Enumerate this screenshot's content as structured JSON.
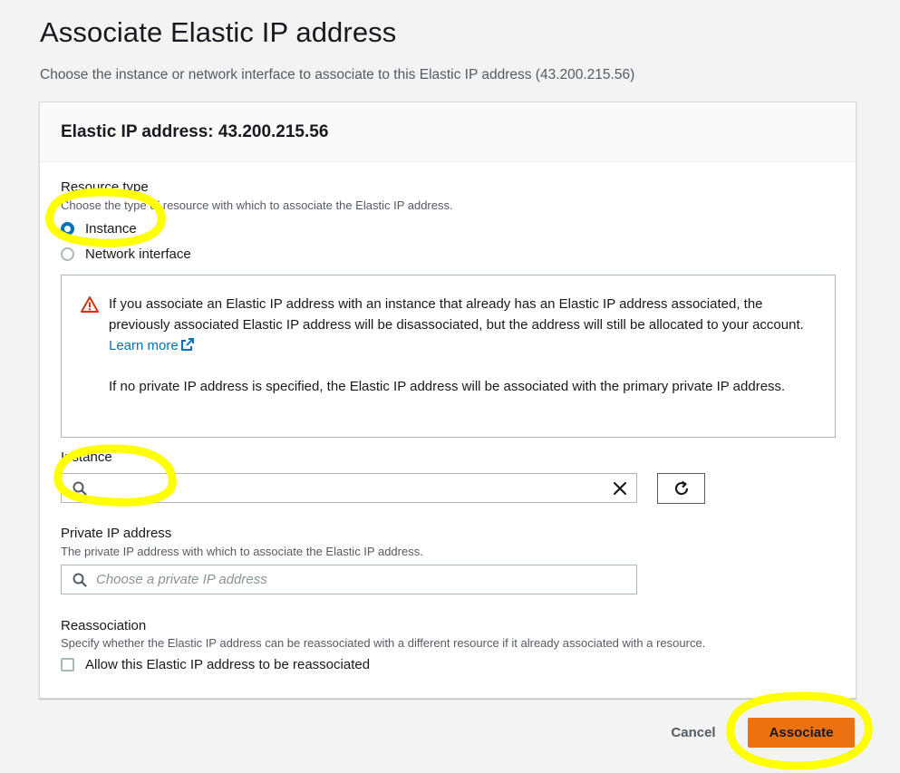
{
  "page": {
    "title": "Associate Elastic IP address",
    "description": "Choose the instance or network interface to associate to this Elastic IP address (43.200.215.56)"
  },
  "card": {
    "title": "Elastic IP address: 43.200.215.56"
  },
  "resource_type": {
    "label": "Resource type",
    "description": "Choose the type of resource with which to associate the Elastic IP address.",
    "options": [
      {
        "label": "Instance",
        "checked": true
      },
      {
        "label": "Network interface",
        "checked": false
      }
    ]
  },
  "alert": {
    "icon": "warning-icon",
    "text_1": "If you associate an Elastic IP address with an instance that already has an Elastic IP address associated, the previously associated Elastic IP address will be disassociated, but the address will still be allocated to your account.",
    "link_label": "Learn more",
    "text_2": "If no private IP address is specified, the Elastic IP address will be associated with the primary private IP address."
  },
  "instance": {
    "label": "Instance",
    "value": "",
    "placeholder": ""
  },
  "private_ip": {
    "label": "Private IP address",
    "description": "The private IP address with which to associate the Elastic IP address.",
    "placeholder": "Choose a private IP address"
  },
  "reassociation": {
    "label": "Reassociation",
    "description": "Specify whether the Elastic IP address can be reassociated with a different resource if it already associated with a resource.",
    "checkbox_label": "Allow this Elastic IP address to be reassociated",
    "checked": false
  },
  "footer": {
    "cancel_label": "Cancel",
    "associate_label": "Associate"
  },
  "colors": {
    "primary": "#ec7211",
    "link": "#0073bb",
    "radio_checked": "#0073bb",
    "warning": "#d13212",
    "annotation_highlight": "#ffff00"
  }
}
